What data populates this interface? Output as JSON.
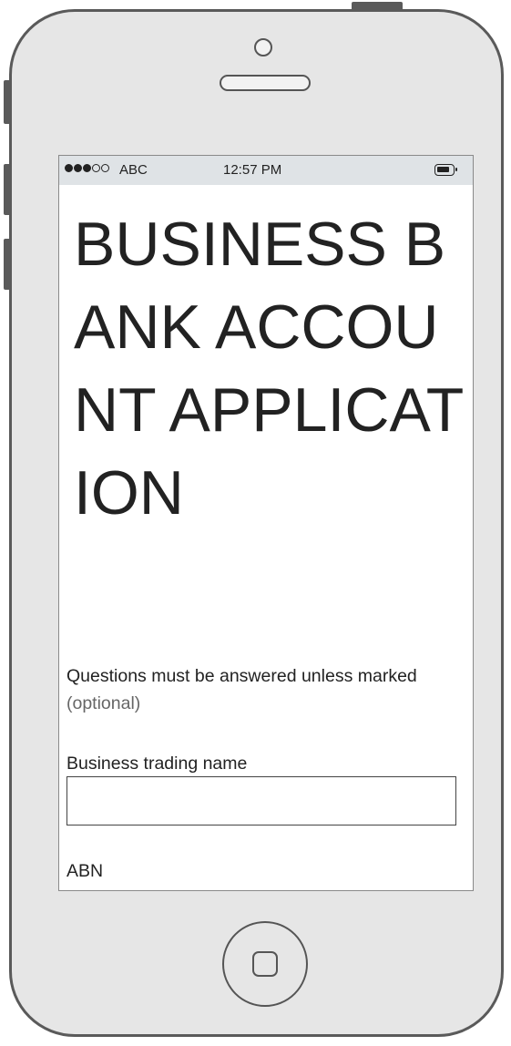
{
  "status_bar": {
    "signal_dots": [
      true,
      true,
      true,
      false,
      false
    ],
    "carrier": "ABC",
    "time": "12:57 PM"
  },
  "page": {
    "title": "BUSINESS BANK ACCOUNT APPLICATION",
    "intro_text": "Questions must be answered unless marked",
    "intro_optional": "(optional)"
  },
  "form": {
    "fields": [
      {
        "label": "Business trading name",
        "value": ""
      },
      {
        "label": "ABN"
      }
    ]
  },
  "colors": {
    "device_body": "#e6e6e6",
    "device_outline": "#5a5a5a",
    "status_bar": "#dfe3e6",
    "text": "#222222"
  },
  "icons": [
    "camera-icon",
    "speaker-icon",
    "battery-icon",
    "home-button-icon"
  ]
}
